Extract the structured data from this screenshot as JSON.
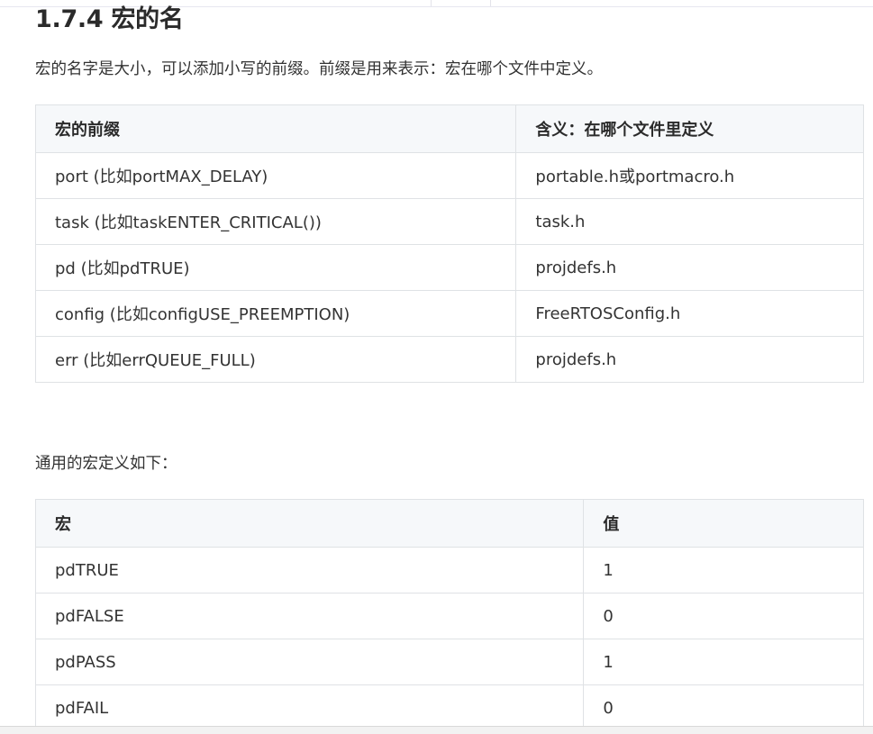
{
  "heading": "1.7.4 宏的名",
  "intro": "宏的名字是大小，可以添加小写的前缀。前缀是用来表示：宏在哪个文件中定义。",
  "prefix_table": {
    "headers": [
      "宏的前缀",
      "含义：在哪个文件里定义"
    ],
    "rows": [
      [
        "port (比如portMAX_DELAY)",
        "portable.h或portmacro.h"
      ],
      [
        "task (比如taskENTER_CRITICAL())",
        "task.h"
      ],
      [
        "pd (比如pdTRUE)",
        "projdefs.h"
      ],
      [
        "config (比如configUSE_PREEMPTION)",
        "FreeRTOSConfig.h"
      ],
      [
        "err (比如errQUEUE_FULL)",
        "projdefs.h"
      ]
    ]
  },
  "common_intro": "通用的宏定义如下：",
  "macros_table": {
    "headers": [
      "宏",
      "值"
    ],
    "rows": [
      [
        "pdTRUE",
        "1"
      ],
      [
        "pdFALSE",
        "0"
      ],
      [
        "pdPASS",
        "1"
      ],
      [
        "pdFAIL",
        "0"
      ]
    ]
  }
}
